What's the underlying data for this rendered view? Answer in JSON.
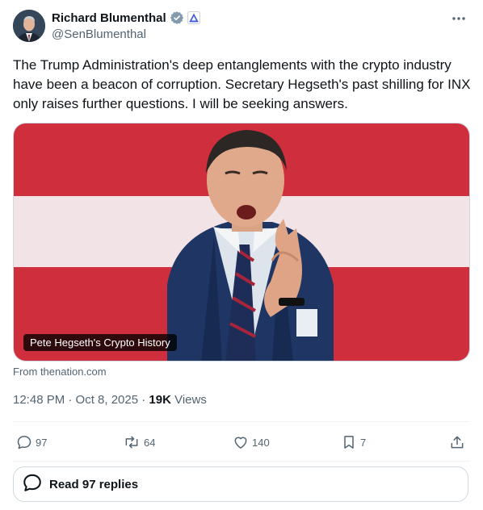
{
  "author": {
    "name": "Richard Blumenthal",
    "handle": "@SenBlumenthal",
    "verified_color": "#829aab",
    "affiliate_color": "#3b5bdb"
  },
  "tweet": {
    "text": "The Trump Administration's deep entanglements with the crypto industry have been a beacon of corruption. Secretary Hegseth's past shilling for INX only raises further questions. I will be seeking answers.",
    "media_caption": "Pete Hegseth's Crypto History",
    "source": "From thenation.com",
    "time": "12:48 PM · Oct 8, 2025 · ",
    "views_count": "19K",
    "views_label": " Views"
  },
  "actions": {
    "replies": "97",
    "reposts": "64",
    "likes": "140",
    "bookmarks": "7"
  },
  "reply_button": {
    "label": "Read 97 replies"
  },
  "icons": [
    "verified-badge-icon",
    "affiliate-badge-icon",
    "more-icon",
    "reply-icon",
    "repost-icon",
    "like-icon",
    "bookmark-icon",
    "share-icon",
    "chat-bubble-icon"
  ]
}
